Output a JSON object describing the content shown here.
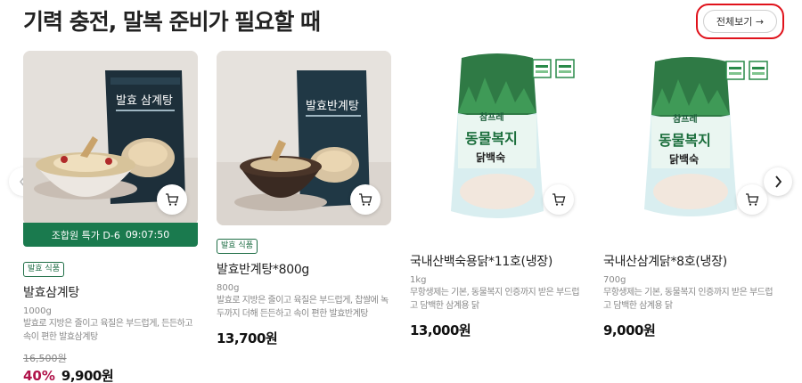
{
  "section": {
    "title": "기력 충전, 말복 준비가 필요할 때",
    "view_all_label": "전체보기 →"
  },
  "products": [
    {
      "tag": "발효 식품",
      "name": "발효삼계탕",
      "weight": "1000g",
      "desc": "발효로 지방은 줄이고 육질은 부드럽게, 든든하고 속이 편한 발효삼계탕",
      "deal_label": "조합원 특가 D-6",
      "deal_timer": "09:07:50",
      "original_price": "16,500원",
      "discount": "40%",
      "price": "9,900원",
      "package_text": "발효 삼계탕"
    },
    {
      "tag": "발효 식품",
      "name": "발효반계탕*800g",
      "weight": "800g",
      "desc": "발효로 지방은 줄이고 육질은 부드럽게, 찹쌀에 녹두까지 더해 든든하고 속이 편한 발효반계탕",
      "price": "13,700원",
      "package_text": "발효반계탕"
    },
    {
      "name": "국내산백숙용닭*11호(냉장)",
      "weight": "1kg",
      "desc": "무항생제는 기본, 동물복지 인증까지 받은 부드럽고 담백한 삼계용 닭",
      "price": "13,000원",
      "package_brand": "참프레",
      "package_title": "동물복지",
      "package_sub": "닭백숙"
    },
    {
      "name": "국내산삼계닭*8호(냉장)",
      "weight": "700g",
      "desc": "무항생제는 기본, 동물복지 인증까지 받은 부드럽고 담백한 삼계용 닭",
      "price": "9,000원",
      "package_brand": "참프레",
      "package_title": "동물복지",
      "package_sub": "닭백숙"
    }
  ],
  "colors": {
    "accent_green": "#1a7a4e",
    "discount_red": "#b0134a",
    "highlight_red": "#e0121b"
  }
}
